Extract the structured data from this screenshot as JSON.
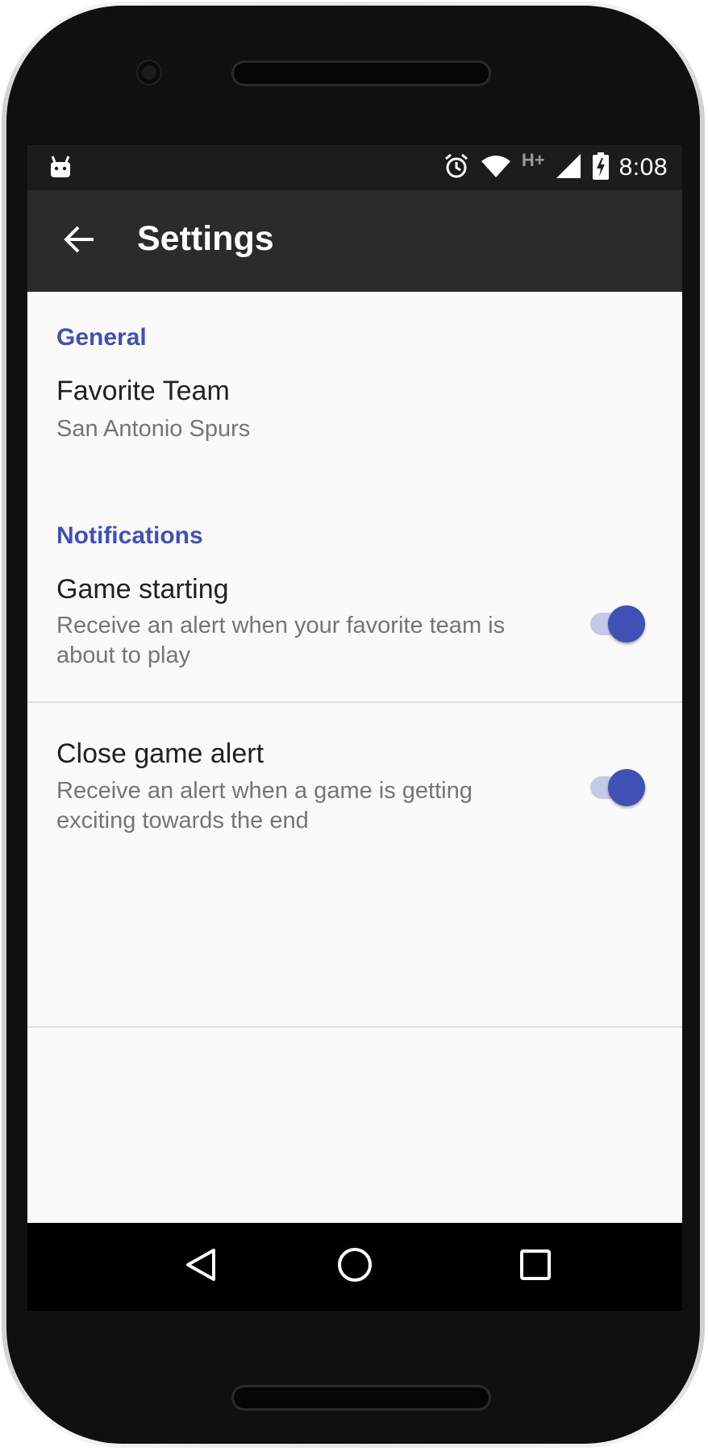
{
  "status_bar": {
    "time": "8:08",
    "network_type": "H+",
    "icons": [
      "android-notification-icon",
      "alarm-icon",
      "wifi-icon",
      "cell-signal-icon",
      "battery-charging-icon"
    ]
  },
  "app_bar": {
    "title": "Settings",
    "back_icon": "arrow-left-icon"
  },
  "sections": {
    "general": {
      "header": "General",
      "favorite_team": {
        "title": "Favorite Team",
        "summary": "San Antonio Spurs"
      }
    },
    "notifications": {
      "header": "Notifications",
      "game_starting": {
        "title": "Game starting",
        "summary": "Receive an alert when your favorite team is about to play",
        "enabled": true
      },
      "close_game_alert": {
        "title": "Close game alert",
        "summary": "Receive an alert when a game is getting exciting towards the end",
        "enabled": true
      }
    }
  },
  "nav_bar": {
    "buttons": [
      "back-triangle-icon",
      "home-circle-icon",
      "recents-square-icon"
    ]
  },
  "colors": {
    "accent": "#3f51b5",
    "switch_track": "#c5cae9",
    "app_bar": "#2b2b2b",
    "status_bar": "#1c1c1c",
    "background": "#fafafa"
  }
}
